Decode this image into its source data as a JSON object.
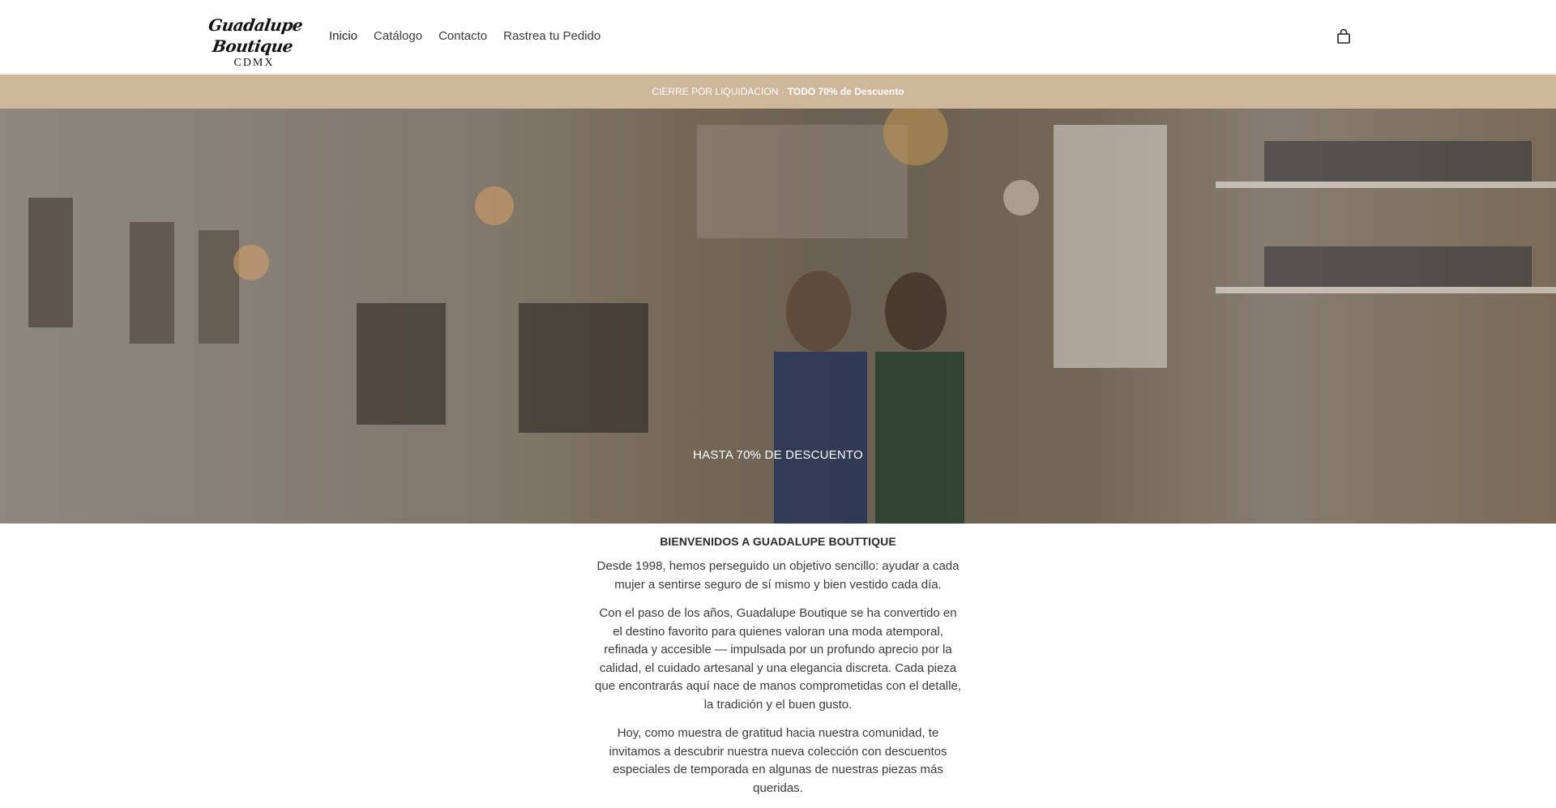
{
  "header": {
    "logo_script": "Guadalupe Boutique",
    "logo_sub": "CDMX",
    "nav": [
      {
        "label": "Inicio"
      },
      {
        "label": "Catálogo"
      },
      {
        "label": "Contacto"
      },
      {
        "label": "Rastrea tu Pedido"
      }
    ],
    "cart_icon": "shopping-bag-icon"
  },
  "announcement": {
    "prefix": "CIERRE POR LIQUIDACION ·",
    "highlight": "TODO 70% de Descuento",
    "background": "#cfb79b"
  },
  "hero": {
    "caption": "HASTA 70% DE DESCUENTO"
  },
  "content": {
    "heading": "BIENVENIDOS A GUADALUPE BOUTTIQUE",
    "paragraphs": [
      "Desde 1998, hemos perseguido un objetivo sencillo: ayudar a cada mujer a sentirse seguro de sí mismo y bien vestido cada día.",
      "Con el paso de los años, Guadalupe Boutique se ha convertido en el destino favorito para quienes valoran una moda atemporal, refinada y accesible — impulsada por un profundo aprecio por la calidad, el cuidado artesanal y una elegancia discreta. Cada pieza que encontrarás aquí nace de manos comprometidas con el detalle, la tradición y el buen gusto.",
      "Hoy, como muestra de gratitud hacia nuestra comunidad, te invitamos a descubrir nuestra nueva colección con descuentos especiales de temporada en algunas de nuestras piezas más queridas."
    ]
  }
}
